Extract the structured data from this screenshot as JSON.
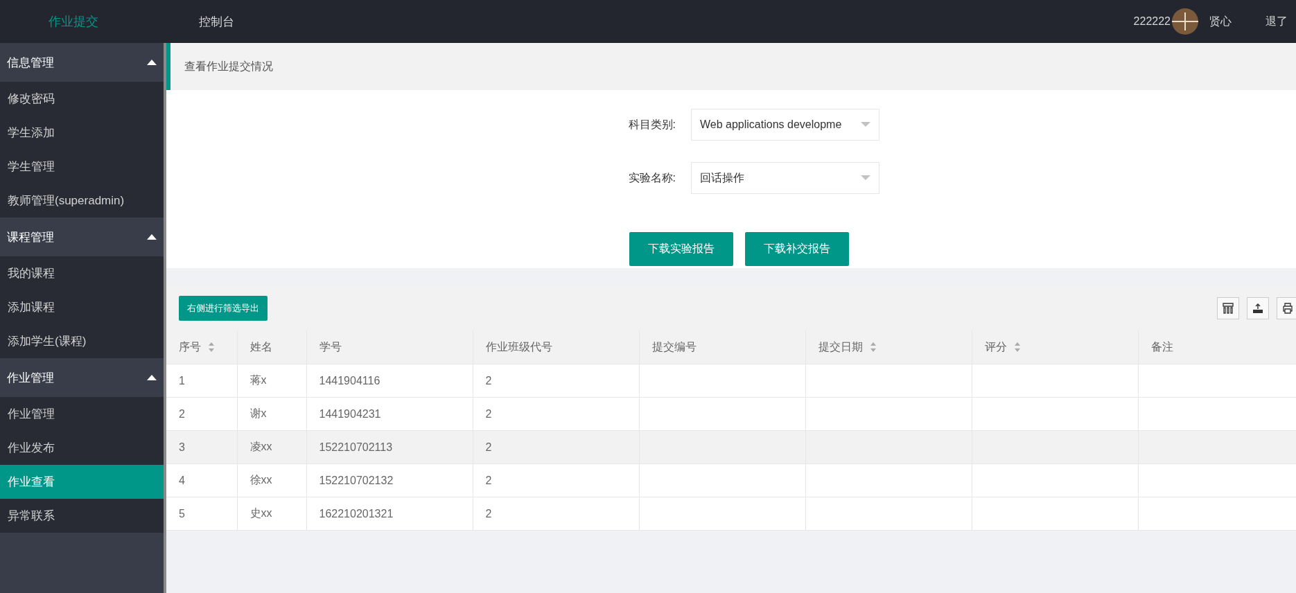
{
  "topbar": {
    "logo": "作业提交",
    "nav": [
      {
        "label": "控制台"
      }
    ],
    "user_id": "222222",
    "user_name": "贤心",
    "logout": "退了"
  },
  "sidebar": {
    "groups": [
      {
        "label": "信息管理",
        "expanded": true,
        "items": [
          {
            "label": "修改密码",
            "selected": false
          },
          {
            "label": "学生添加",
            "selected": false
          },
          {
            "label": "学生管理",
            "selected": false
          },
          {
            "label": "教师管理(superadmin)",
            "selected": false
          }
        ]
      },
      {
        "label": "课程管理",
        "expanded": true,
        "items": [
          {
            "label": "我的课程",
            "selected": false
          },
          {
            "label": "添加课程",
            "selected": false
          },
          {
            "label": "添加学生(课程)",
            "selected": false
          }
        ]
      },
      {
        "label": "作业管理",
        "expanded": true,
        "items": [
          {
            "label": "作业管理",
            "selected": false
          },
          {
            "label": "作业发布",
            "selected": false
          },
          {
            "label": "作业查看",
            "selected": true
          },
          {
            "label": "异常联系",
            "selected": false
          }
        ]
      }
    ]
  },
  "page_title": "查看作业提交情况",
  "form": {
    "fields": [
      {
        "label": "科目类别:",
        "value": "Web applications developme"
      },
      {
        "label": "实验名称:",
        "value": "回话操作"
      }
    ],
    "buttons": [
      "下载实验报告",
      "下载补交报告"
    ]
  },
  "table": {
    "export_button": "右侧进行筛选导出",
    "columns": [
      {
        "label": "序号",
        "sortable": true
      },
      {
        "label": "姓名",
        "sortable": false
      },
      {
        "label": "学号",
        "sortable": false
      },
      {
        "label": "作业班级代号",
        "sortable": false
      },
      {
        "label": "提交编号",
        "sortable": false
      },
      {
        "label": "提交日期",
        "sortable": true
      },
      {
        "label": "评分",
        "sortable": true
      },
      {
        "label": "备注",
        "sortable": false
      }
    ],
    "rows": [
      {
        "highlighted": false,
        "cells": [
          "1",
          "蒋x",
          "1441904116",
          "2",
          "",
          "",
          "",
          ""
        ]
      },
      {
        "highlighted": false,
        "cells": [
          "2",
          "谢x",
          "1441904231",
          "2",
          "",
          "",
          "",
          ""
        ]
      },
      {
        "highlighted": true,
        "cells": [
          "3",
          "凌xx",
          "152210702113",
          "2",
          "",
          "",
          "",
          ""
        ]
      },
      {
        "highlighted": false,
        "cells": [
          "4",
          "徐xx",
          "152210702132",
          "2",
          "",
          "",
          "",
          ""
        ]
      },
      {
        "highlighted": false,
        "cells": [
          "5",
          "史xx",
          "162210201321",
          "2",
          "",
          "",
          "",
          ""
        ]
      }
    ]
  }
}
